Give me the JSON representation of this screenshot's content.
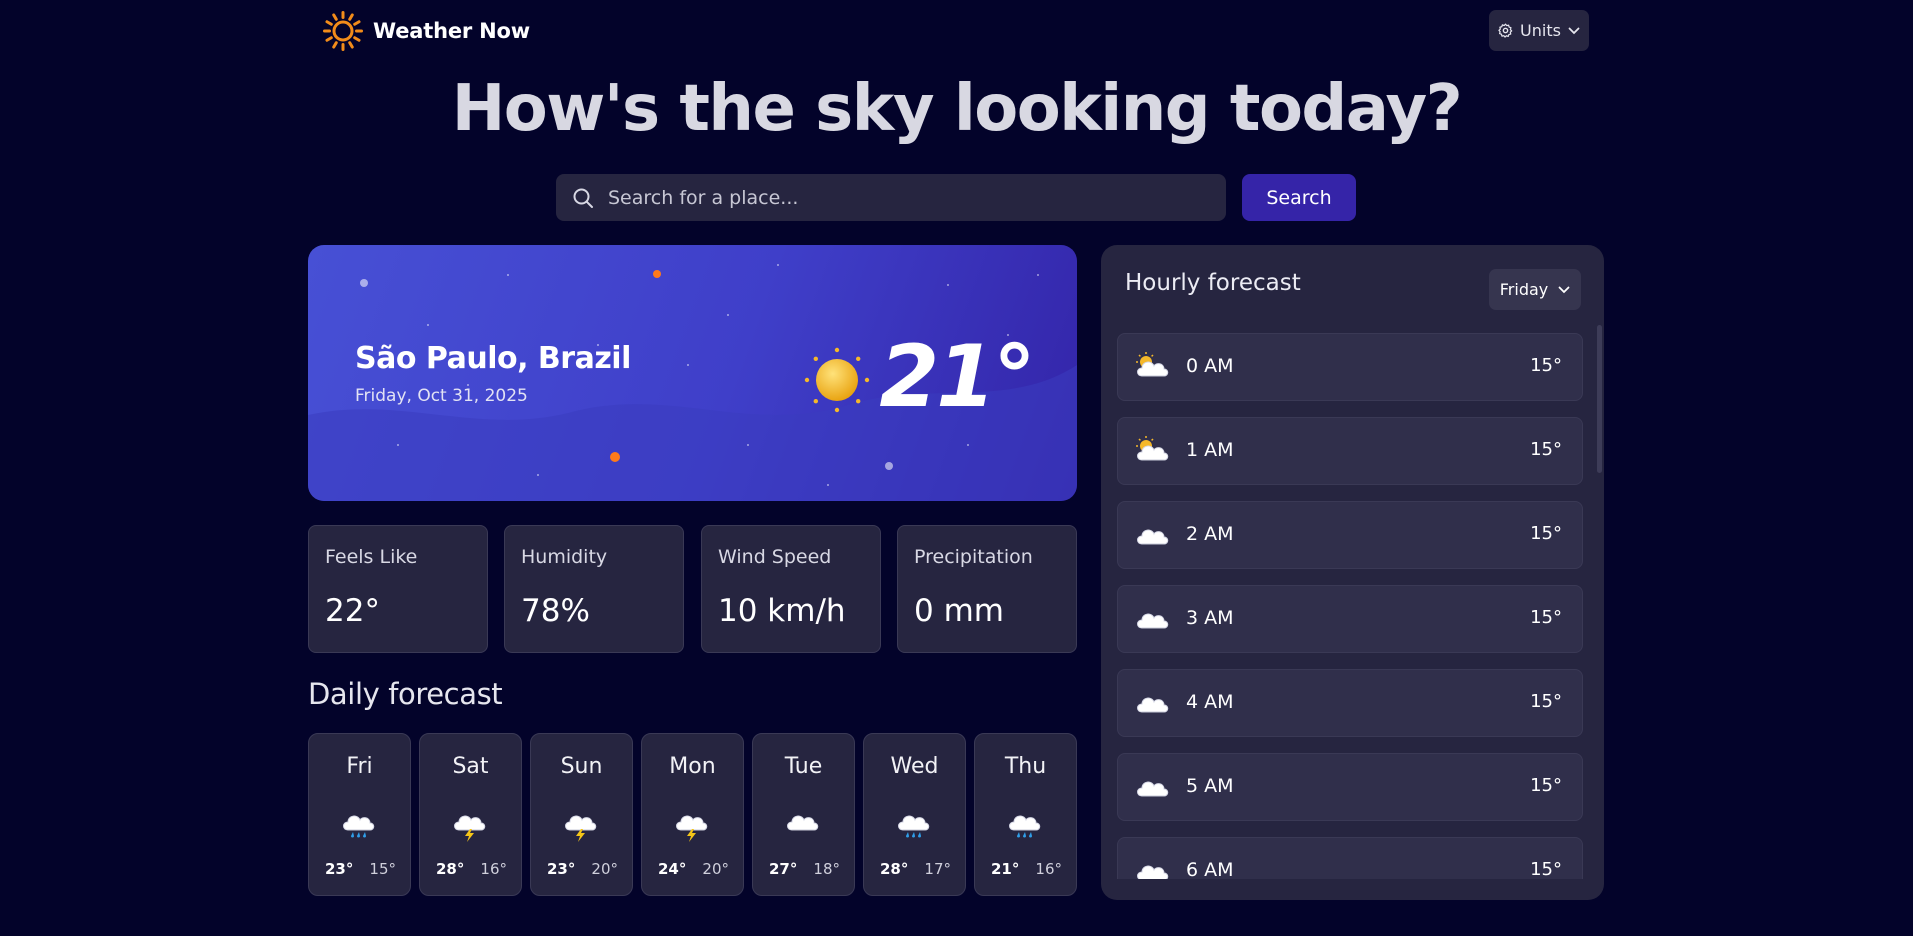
{
  "app": {
    "name": "Weather Now"
  },
  "header": {
    "units_label": "Units",
    "units_icon": "gear-icon"
  },
  "hero": {
    "title": "How's the sky looking today?"
  },
  "search": {
    "placeholder": "Search for a place...",
    "value": "",
    "button_label": "Search"
  },
  "current": {
    "location": "São Paulo, Brazil",
    "date": "Friday, Oct 31, 2025",
    "temperature": "21°",
    "icon": "sunny-icon"
  },
  "stats": [
    {
      "label": "Feels Like",
      "value": "22°"
    },
    {
      "label": "Humidity",
      "value": "78%"
    },
    {
      "label": "Wind Speed",
      "value": "10 km/h"
    },
    {
      "label": "Precipitation",
      "value": "0 mm"
    }
  ],
  "daily": {
    "title": "Daily forecast",
    "days": [
      {
        "name": "Fri",
        "high": "23°",
        "low": "15°",
        "icon": "rain-icon"
      },
      {
        "name": "Sat",
        "high": "28°",
        "low": "16°",
        "icon": "storm-icon"
      },
      {
        "name": "Sun",
        "high": "23°",
        "low": "20°",
        "icon": "storm-icon"
      },
      {
        "name": "Mon",
        "high": "24°",
        "low": "20°",
        "icon": "storm-icon"
      },
      {
        "name": "Tue",
        "high": "27°",
        "low": "18°",
        "icon": "cloud-icon"
      },
      {
        "name": "Wed",
        "high": "28°",
        "low": "17°",
        "icon": "rain-icon"
      },
      {
        "name": "Thu",
        "high": "21°",
        "low": "16°",
        "icon": "rain-icon"
      }
    ]
  },
  "hourly": {
    "title": "Hourly forecast",
    "selected_day": "Friday",
    "hours": [
      {
        "time": "0 AM",
        "temp": "15°",
        "icon": "partly-cloudy-icon"
      },
      {
        "time": "1 AM",
        "temp": "15°",
        "icon": "partly-cloudy-icon"
      },
      {
        "time": "2 AM",
        "temp": "15°",
        "icon": "cloud-icon"
      },
      {
        "time": "3 AM",
        "temp": "15°",
        "icon": "cloud-icon"
      },
      {
        "time": "4 AM",
        "temp": "15°",
        "icon": "cloud-icon"
      },
      {
        "time": "5 AM",
        "temp": "15°",
        "icon": "cloud-icon"
      },
      {
        "time": "6 AM",
        "temp": "15°",
        "icon": "cloud-icon"
      }
    ]
  },
  "colors": {
    "background": "#03032a",
    "panel": "#262540",
    "accent": "#3524a8",
    "sun": "#f5b82a",
    "logo": "#f28c1a"
  }
}
